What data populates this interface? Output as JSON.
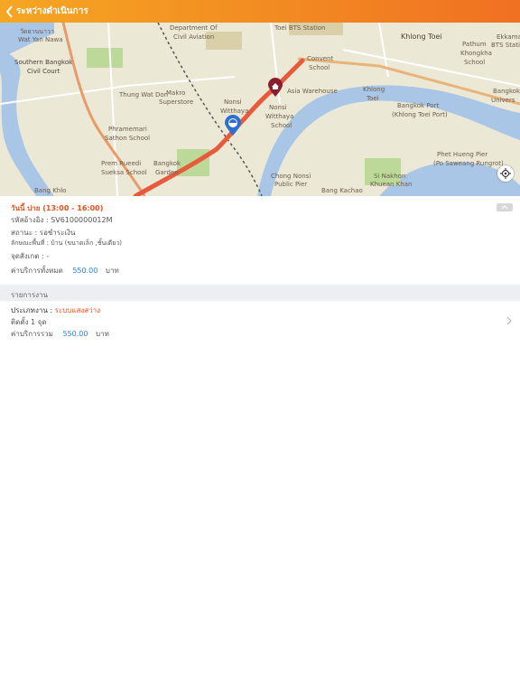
{
  "header": {
    "title": "ระหว่างดำเนินการ"
  },
  "map": {
    "labels": [
      "Department Of",
      "Civil Aviation",
      "Toei BTS Station",
      "Khlong Toei",
      "Pathum",
      "Khongkha",
      "School",
      "Ekkamai",
      "BTS Station",
      "วัดยานนาวา",
      "Wat Yan Nawa",
      "Southern Bangkok",
      "Civil Court",
      "Convent",
      "School",
      "Asia Warehouse",
      "Khlong",
      "Toei",
      "Bangkok Port",
      "(Khlong Toei Port)",
      "Makro",
      "Superstore",
      "Nonsi",
      "Witthaya",
      "Nonsi",
      "Witthaya",
      "School",
      "Phramemari",
      "Sathon School",
      "Prem Rueedi",
      "Sueksa School",
      "Bangkok",
      "Garden",
      "Chong Nonsi",
      "Public Pier",
      "Si Nakhon",
      "Khuean Khan",
      "Phet Hueng Pier",
      "(Po Saweang Rungrot)",
      "Bang Khlo",
      "Bang Kachao",
      "Thung Wat Don",
      "Bangkok",
      "Univers"
    ]
  },
  "detail": {
    "date": "วันนี้ บ่าย (13:00 - 16:00)",
    "ref": "รหัสอ้างอิง : SV6100000012M",
    "status": "สถานะ : รอชำระเงิน",
    "property": "ลักษณะพื้นที่ : บ้าน (ขนาดเล็ก ,ชั้นเดียว)",
    "landmark": "จุดสังเกต : -",
    "total_label": "ค่าบริการทั้งหมด",
    "total_value": "550.00",
    "currency": "บาท"
  },
  "section": {
    "title": "รายการงาน"
  },
  "job": {
    "type_label": "ประเภทงาน : ",
    "type_value": "ระบบแสงสว่าง",
    "qty": "ติดตั้ง 1 จุด",
    "subtotal_label": "ค่าบริการรวม",
    "subtotal_value": "550.00",
    "currency": "บาท"
  },
  "colors": {
    "accent": "#f07022",
    "orange_text": "#e8501e",
    "price_blue": "#2d7fd6"
  },
  "icons": [
    "back-chevron-icon",
    "home-pin-icon",
    "worker-pin-icon",
    "locate-icon",
    "collapse-icon",
    "chevron-right-icon"
  ]
}
